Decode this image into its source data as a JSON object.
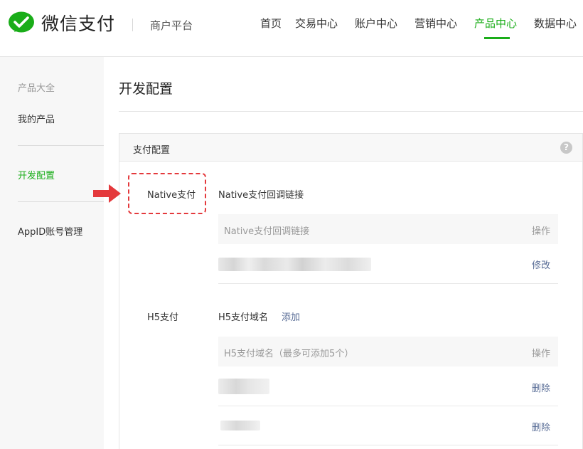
{
  "header": {
    "brand": "微信支付",
    "platform": "商户平台",
    "nav": [
      {
        "label": "首页"
      },
      {
        "label": "交易中心"
      },
      {
        "label": "账户中心"
      },
      {
        "label": "营销中心"
      },
      {
        "label": "产品中心"
      },
      {
        "label": "数据中心"
      }
    ],
    "active_nav": "产品中心"
  },
  "sidebar": {
    "items": [
      {
        "label": "产品大全"
      },
      {
        "label": "我的产品"
      },
      {
        "label": "开发配置"
      },
      {
        "label": "AppID账号管理"
      }
    ],
    "active": "开发配置"
  },
  "main": {
    "page_title": "开发配置",
    "panel_title": "支付配置",
    "help_glyph": "?",
    "native": {
      "label": "Native支付",
      "title": "Native支付回调链接",
      "table_header": "Native支付回调链接",
      "action_header": "操作",
      "row_action": "修改"
    },
    "h5": {
      "label": "H5支付",
      "title": "H5支付域名",
      "add": "添加",
      "table_header": "H5支付域名（最多可添加5个）",
      "action_header": "操作",
      "rows": [
        {
          "action": "删除"
        },
        {
          "action": "删除"
        }
      ]
    }
  },
  "colors": {
    "accent_green": "#1aad19",
    "link_blue": "#576b95",
    "highlight_red": "#e4393c"
  }
}
